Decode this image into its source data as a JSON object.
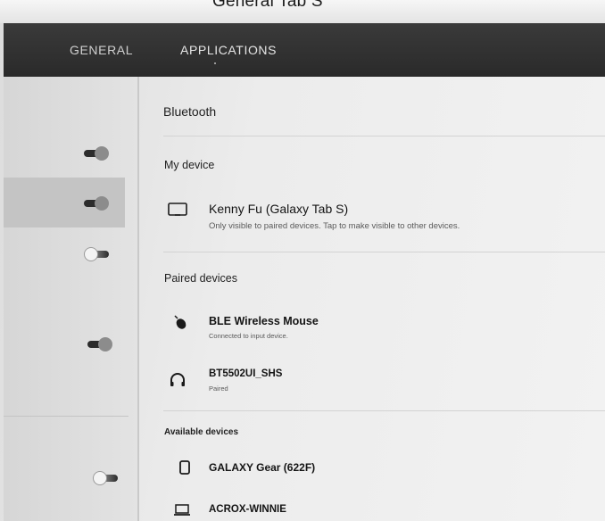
{
  "header": {
    "partial_title": "General Tab S"
  },
  "tabs": [
    {
      "label": "GENERAL"
    },
    {
      "label": "APPLICATIONS"
    }
  ],
  "bluetooth": {
    "title": "Bluetooth",
    "my_device_label": "My device",
    "my_device": {
      "name": "Kenny Fu (Galaxy Tab S)",
      "status": "Only visible to paired devices. Tap to make visible to other devices.",
      "icon": "tablet-icon"
    },
    "paired_label": "Paired devices",
    "paired": [
      {
        "name": "BLE Wireless Mouse",
        "status": "Connected to input device.",
        "icon": "mouse-icon"
      },
      {
        "name": "BT5502UI_SHS",
        "status": "Paired",
        "icon": "headphones-icon"
      }
    ],
    "available_label": "Available devices",
    "available": [
      {
        "name": "GALAXY Gear (622F)",
        "icon": "watch-icon"
      },
      {
        "name": "ACROX-WINNIE",
        "icon": "laptop-icon"
      }
    ]
  },
  "left_toggles": [
    {
      "state": "on"
    },
    {
      "state": "on"
    },
    {
      "state": "off"
    },
    {
      "state": "on"
    },
    {
      "state": "off"
    }
  ],
  "colors": {
    "tabbar": "#2f2f2f",
    "toggle_on": "#2c2c2c",
    "toggle_off": "#f4f4f4"
  }
}
